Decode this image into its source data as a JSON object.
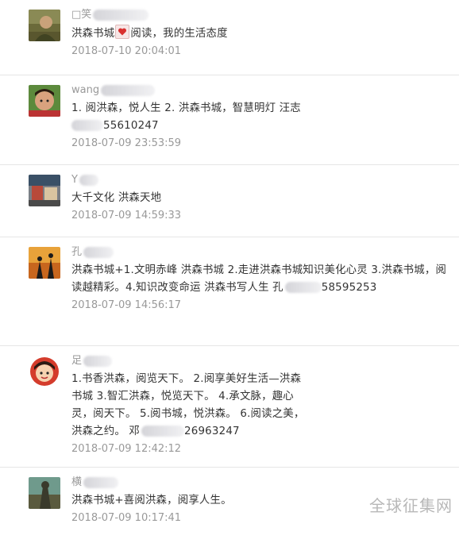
{
  "comments": [
    {
      "name": "□笑",
      "content_a": "洪森书城",
      "content_b": "阅读，我的生活态度",
      "time": "2018-07-10 20:04:01"
    },
    {
      "name": "wang",
      "content": "1. 阅洪森，悦人生 2. 洪森书城，智慧明灯 汪志",
      "content_tail": "55610247",
      "time": "2018-07-09 23:53:59"
    },
    {
      "name": "Y",
      "content": "大千文化 洪森天地",
      "time": "2018-07-09 14:59:33"
    },
    {
      "name": "孔",
      "content": "洪森书城+1.文明赤峰 洪森书城 2.走进洪森书城知识美化心灵 3.洪森书城，阅读越精彩。4.知识改变命运 洪森书写人生 孔",
      "content_tail": "58595253",
      "time": "2018-07-09 14:56:17"
    },
    {
      "name": "足",
      "content": "1.书香洪森，阅览天下。 2.阅享美好生活—洪森书城 3.智汇洪森，悦览天下。 4.承文脉，趣心灵，阅天下。 5.阅书城，悦洪森。 6.阅读之美，洪森之约。 邓",
      "content_tail": "26963247",
      "time": "2018-07-09 12:42:12"
    },
    {
      "name": "横",
      "content": "洪森书城+喜阅洪森，阅享人生。",
      "time": "2018-07-09 10:17:41"
    }
  ],
  "watermark": "全球征集网",
  "icons": {
    "inline_emoji": "heart-icon"
  },
  "colors": {
    "text": "#333333",
    "meta": "#999999",
    "divider": "#e6e6e6",
    "heart": "#d9302f"
  }
}
